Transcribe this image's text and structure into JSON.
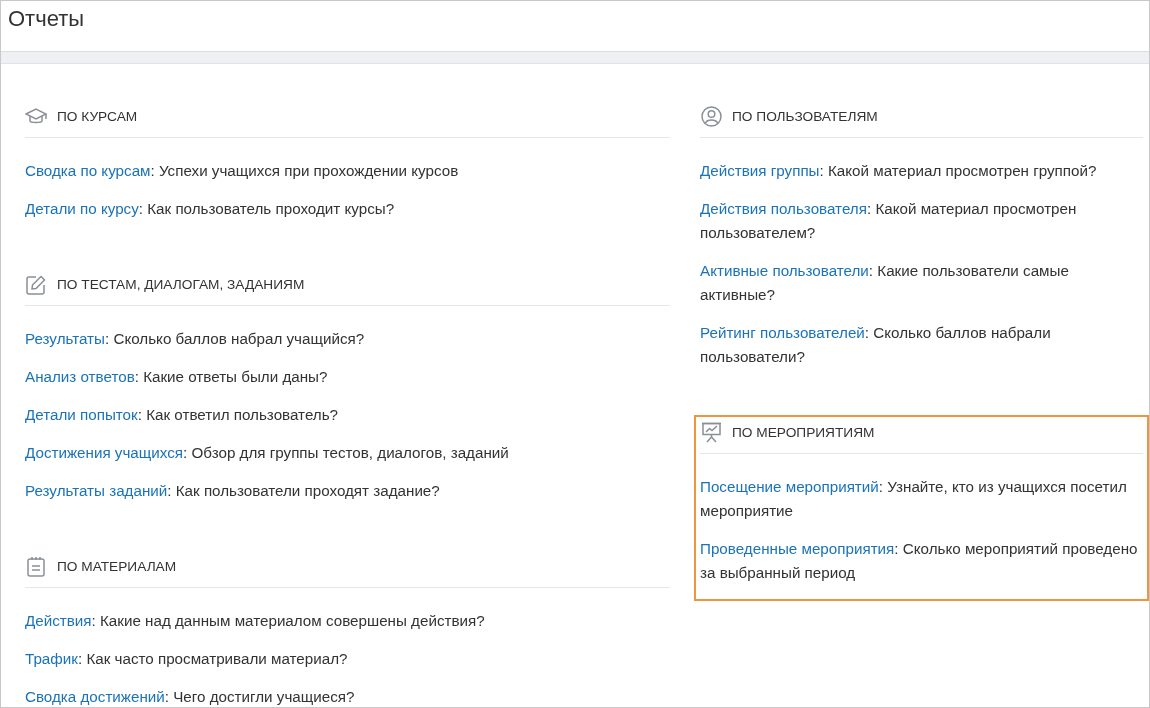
{
  "page": {
    "title": "Отчеты"
  },
  "columns": [
    {
      "sections": [
        {
          "kind": "courses",
          "title": "ПО КУРСАМ",
          "highlighted": false,
          "items": [
            {
              "link": "Сводка по курсам",
              "text": ": Успехи учащихся при прохождении курсов"
            },
            {
              "link": "Детали по курсу",
              "text": ": Как пользователь проходит курсы?"
            }
          ]
        },
        {
          "kind": "tests",
          "title": "ПО ТЕСТАМ, ДИАЛОГАМ, ЗАДАНИЯМ",
          "highlighted": false,
          "items": [
            {
              "link": "Результаты",
              "text": ": Сколько баллов набрал учащийся?"
            },
            {
              "link": "Анализ ответов",
              "text": ": Какие ответы были даны?"
            },
            {
              "link": "Детали попыток",
              "text": ": Как ответил пользователь?"
            },
            {
              "link": "Достижения учащихся",
              "text": ": Обзор для группы тестов, диалогов, заданий"
            },
            {
              "link": "Результаты заданий",
              "text": ": Как пользователи проходят задание?"
            }
          ]
        },
        {
          "kind": "materials",
          "title": "ПО МАТЕРИАЛАМ",
          "highlighted": false,
          "items": [
            {
              "link": "Действия",
              "text": ": Какие над данным материалом совершены действия?"
            },
            {
              "link": "Трафик",
              "text": ": Как часто просматривали материал?"
            },
            {
              "link": "Сводка достижений",
              "text": ": Чего достигли учащиеся?"
            }
          ]
        }
      ]
    },
    {
      "sections": [
        {
          "kind": "users",
          "title": "ПО ПОЛЬЗОВАТЕЛЯМ",
          "highlighted": false,
          "items": [
            {
              "link": "Действия группы",
              "text": ": Какой материал просмотрен группой?"
            },
            {
              "link": "Действия пользователя",
              "text": ": Какой материал просмотрен пользователем?"
            },
            {
              "link": "Активные пользователи",
              "text": ": Какие пользователи самые активные?"
            },
            {
              "link": "Рейтинг пользователей",
              "text": ": Сколько баллов набрали пользователи?"
            }
          ]
        },
        {
          "kind": "events",
          "title": "ПО МЕРОПРИЯТИЯМ",
          "highlighted": true,
          "items": [
            {
              "link": "Посещение мероприятий",
              "text": ": Узнайте, кто из учащихся посетил мероприятие"
            },
            {
              "link": "Проведенные мероприятия",
              "text": ": Сколько мероприятий проведено за выбранный период"
            }
          ]
        }
      ]
    }
  ]
}
